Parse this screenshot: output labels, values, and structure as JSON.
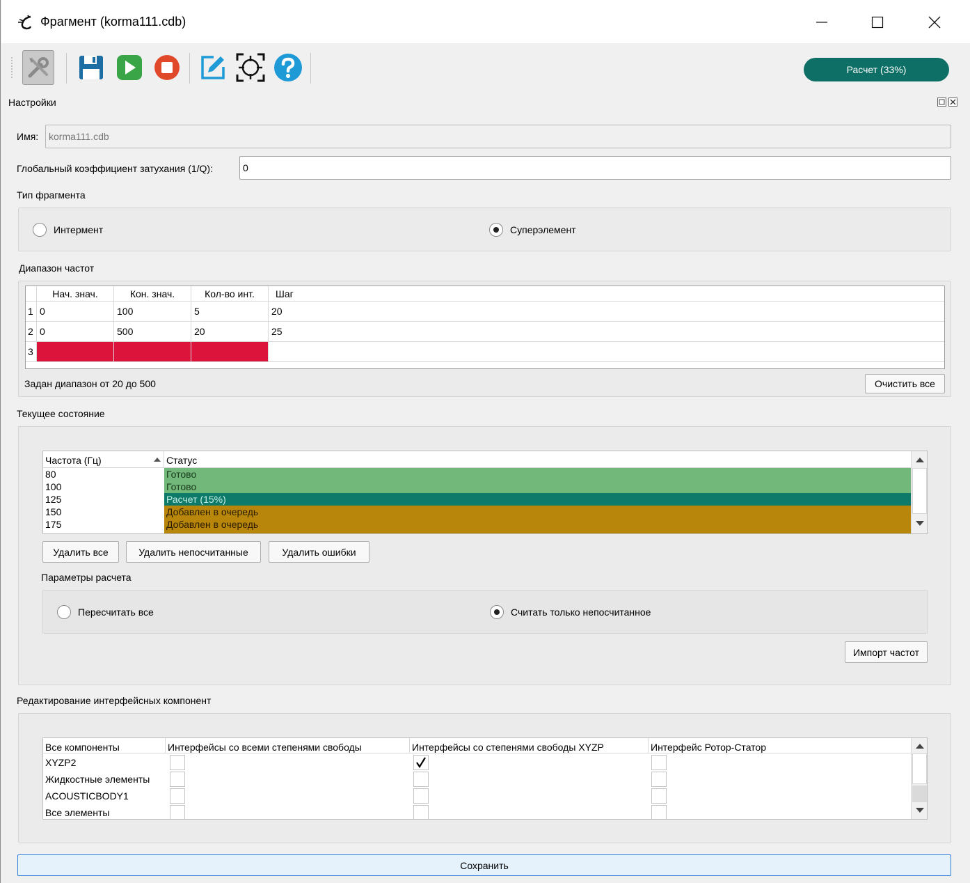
{
  "window": {
    "title": "Фрагмент (korma111.cdb)"
  },
  "toolbar": {
    "progress_label": "Расчет (33%)"
  },
  "dock": {
    "title": "Настройки"
  },
  "form": {
    "name_label": "Имя:",
    "name_value": "korma111.cdb",
    "damping_label": "Глобальный коэффициент затухания (1/Q):",
    "damping_value": "0",
    "fragment_type_label": "Тип фрагмента",
    "radio_interment": "Интермент",
    "radio_superelement": "Суперэлемент",
    "selected_type": "Суперэлемент"
  },
  "freq_range": {
    "label": "Диапазон частот",
    "headers": [
      "Нач. знач.",
      "Кон. знач.",
      "Кол-во инт.",
      "Шаг"
    ],
    "rows": [
      {
        "num": "1",
        "cells": [
          "0",
          "100",
          "5",
          "20"
        ]
      },
      {
        "num": "2",
        "cells": [
          "0",
          "500",
          "20",
          "25"
        ]
      },
      {
        "num": "3",
        "cells": [
          "",
          "",
          "",
          ""
        ]
      }
    ],
    "error_color": "#dc143c",
    "summary": "Задан диапазон от 20 до 500",
    "clear_button": "Очистить все"
  },
  "current_state": {
    "label": "Текущее состояние",
    "col_freq": "Частота (Гц)",
    "col_status": "Статус",
    "rows": [
      {
        "freq": "80",
        "status": "Готово",
        "color": "#72b87a"
      },
      {
        "freq": "100",
        "status": "Готово",
        "color": "#72b87a"
      },
      {
        "freq": "125",
        "status": "Расчет (15%)",
        "color": "#0e7a6a"
      },
      {
        "freq": "150",
        "status": "Добавлен в очередь",
        "color": "#b8860b"
      },
      {
        "freq": "175",
        "status": "Добавлен в очередь",
        "color": "#b8860b"
      }
    ],
    "btn_delete_all": "Удалить все",
    "btn_delete_uncalc": "Удалить непосчитанные",
    "btn_delete_errors": "Удалить ошибки",
    "calc_params_label": "Параметры расчета",
    "radio_recalc_all": "Пересчитать все",
    "radio_calc_uncalc": "Считать только непосчитанное",
    "selected_mode": "Считать только непосчитанное",
    "btn_import": "Импорт частот"
  },
  "interfaces": {
    "label": "Редактирование интерфейсных компонент",
    "headers": [
      "Все компоненты",
      "Интерфейсы со всеми степенями свободы",
      "Интерфейсы со степенями свободы XYZP",
      "Интерфейс Ротор-Статор"
    ],
    "rows": [
      {
        "name": "XYZP2",
        "all_dof": false,
        "xyzp": true,
        "rotor_stator": false
      },
      {
        "name": "Жидкостные элементы",
        "all_dof": false,
        "xyzp": false,
        "rotor_stator": false
      },
      {
        "name": "ACOUSTICBODY1",
        "all_dof": false,
        "xyzp": false,
        "rotor_stator": false
      },
      {
        "name": "Все элементы",
        "all_dof": false,
        "xyzp": false,
        "rotor_stator": false
      }
    ]
  },
  "footer": {
    "save_button": "Сохранить"
  },
  "icons": [
    "app-icon",
    "settings-tools-icon",
    "save-icon",
    "play-icon",
    "stop-icon",
    "edit-icon",
    "target-icon",
    "help-icon",
    "minimize-icon",
    "maximize-icon",
    "close-icon",
    "dock-float-icon",
    "dock-close-icon",
    "sort-up-icon",
    "scroll-up-icon",
    "scroll-down-icon",
    "checkmark-icon"
  ]
}
